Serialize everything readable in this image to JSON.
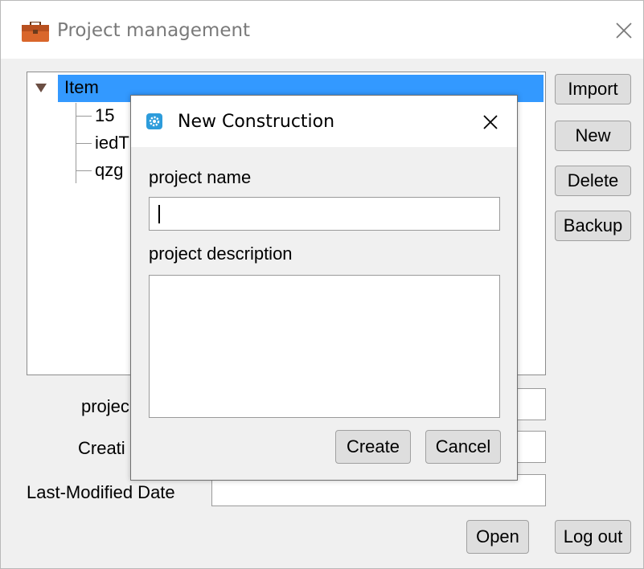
{
  "window": {
    "title": "Project management",
    "icon": "briefcase-icon",
    "close_icon": "close-icon"
  },
  "tree": {
    "root_label": "Item",
    "children": [
      "15",
      "iedT",
      "qzg"
    ]
  },
  "side_buttons": {
    "import": "Import",
    "new": "New",
    "delete": "Delete",
    "backup": "Backup"
  },
  "form": {
    "project_label": "projec",
    "creation_label": "Creati",
    "last_modified_label": "Last-Modified Date",
    "project_value": "",
    "creation_value": "",
    "last_modified_value": ""
  },
  "bottom_buttons": {
    "open": "Open",
    "logout": "Log out"
  },
  "dialog": {
    "title": "New Construction",
    "icon": "gear-icon",
    "name_label": "project name",
    "name_value": "",
    "description_label": "project description",
    "description_value": "",
    "create": "Create",
    "cancel": "Cancel"
  },
  "colors": {
    "selection": "#3399ff",
    "dialog_icon": "#2d9cdb",
    "briefcase": "#d9662b"
  }
}
